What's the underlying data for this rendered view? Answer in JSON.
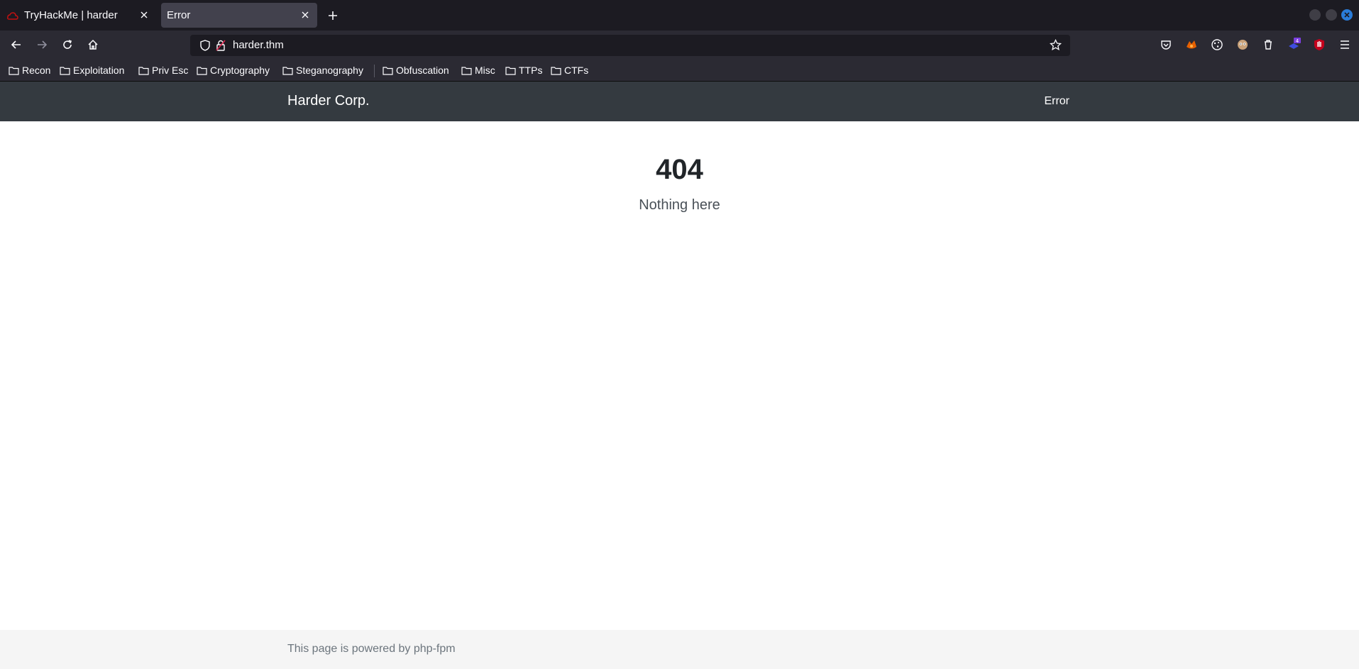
{
  "browser": {
    "tabs": [
      {
        "label": "TryHackMe | harder",
        "active": false
      },
      {
        "label": "Error",
        "active": true
      }
    ],
    "url": "harder.thm",
    "extensions_badge": "4",
    "bookmarks": [
      "Recon",
      "Exploitation",
      "Priv Esc",
      "Cryptography",
      "Steganography",
      "Obfuscation",
      "Misc",
      "TTPs",
      "CTFs"
    ]
  },
  "site": {
    "brand": "Harder Corp.",
    "nav_link": "Error",
    "error_code": "404",
    "error_message": "Nothing here",
    "footer": "This page is powered by php-fpm"
  },
  "colors": {
    "chrome_dark": "#1c1b22",
    "chrome": "#2b2a33",
    "site_navbar": "#343a40",
    "footer_bg": "#f5f5f5",
    "close_button": "#2a7cd8"
  }
}
